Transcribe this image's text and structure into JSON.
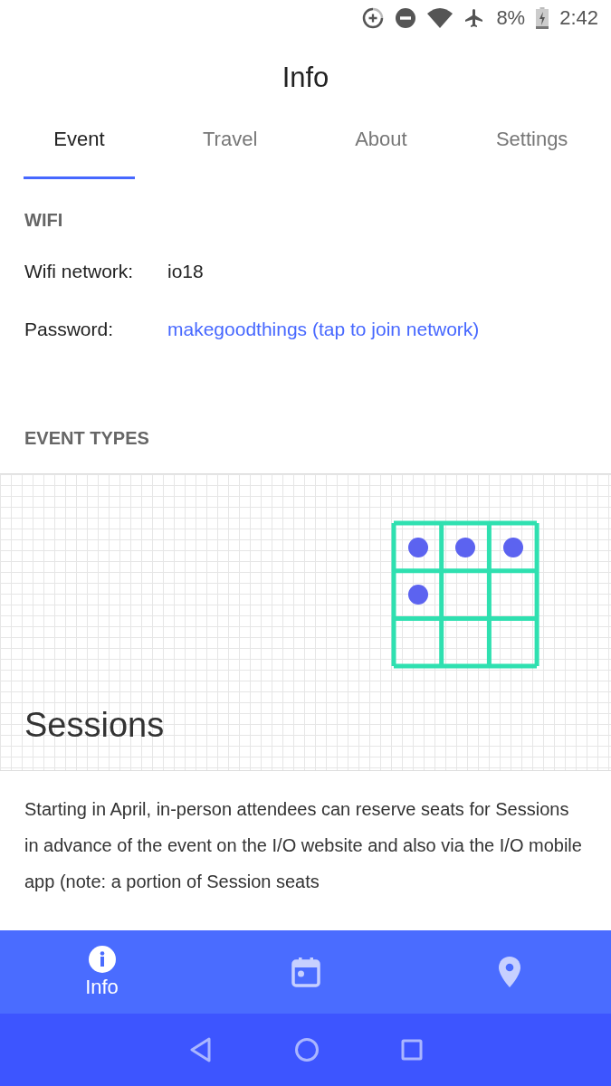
{
  "status_bar": {
    "battery": "8%",
    "time": "2:42"
  },
  "title": "Info",
  "tabs": [
    {
      "label": "Event",
      "selected": true
    },
    {
      "label": "Travel",
      "selected": false
    },
    {
      "label": "About",
      "selected": false
    },
    {
      "label": "Settings",
      "selected": false
    }
  ],
  "wifi": {
    "heading": "WIFI",
    "rows": [
      {
        "label": "Wifi network:",
        "value": "io18",
        "kind": "text"
      },
      {
        "label": "Password:",
        "value": "makegoodthings (tap to join network)",
        "kind": "link"
      }
    ]
  },
  "event_types": {
    "heading": "EVENT TYPES",
    "title": "Sessions",
    "description": "Starting in April, in-person attendees can reserve seats for Sessions in advance of the event on the I/O website and also via the I/O mobile app (note: a portion of Session seats"
  },
  "bottom_nav": [
    {
      "kind": "info",
      "label": "Info",
      "selected": true
    },
    {
      "kind": "calendar",
      "selected": false
    },
    {
      "kind": "map",
      "selected": false
    }
  ]
}
